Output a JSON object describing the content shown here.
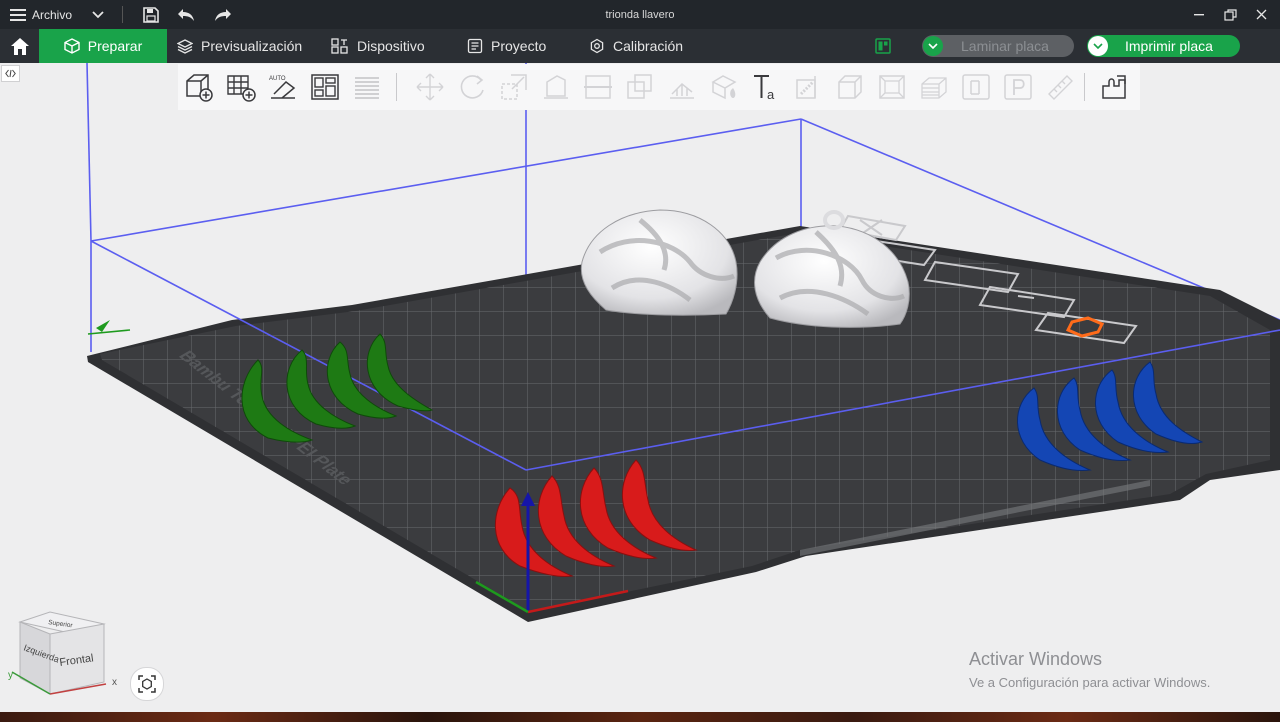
{
  "app": {
    "menu_label": "Archivo",
    "window_title": "trionda llavero"
  },
  "nav": {
    "tabs": [
      {
        "label": "Preparar",
        "icon": "cube-icon",
        "active": true
      },
      {
        "label": "Previsualización",
        "icon": "layers-icon",
        "active": false
      },
      {
        "label": "Dispositivo",
        "icon": "device-icon",
        "active": false
      },
      {
        "label": "Proyecto",
        "icon": "project-icon",
        "active": false
      },
      {
        "label": "Calibración",
        "icon": "calibration-icon",
        "active": false
      }
    ],
    "slice_label": "Laminar placa",
    "print_label": "Imprimir placa"
  },
  "colors": {
    "accent": "#19a34a",
    "titlebar": "#22262b",
    "menubar": "#2b2f34",
    "bed": "#3b3c3f",
    "bounding_box": "#5b5ef0",
    "part_white": "#e8e8ea",
    "part_green": "#1e7a14",
    "part_red": "#d81b1b",
    "part_blue": "#1446b4"
  },
  "toolbar": {
    "items": [
      "add-object-icon",
      "add-plate-icon",
      "auto-arrange-icon",
      "orient-icon",
      "arrange-plate-icon",
      "layers-stack-icon",
      "move-icon",
      "rotate-icon",
      "scale-icon",
      "lay-on-face-icon",
      "cut-icon",
      "boolean-icon",
      "support-paint-icon",
      "seam-paint-icon",
      "text-icon",
      "measure-icon",
      "assembly-icon",
      "emboss-icon",
      "svg-icon",
      "variable-layer-icon",
      "brim-ears-icon",
      "height-range-icon",
      "ruler-icon",
      "split-icon"
    ]
  },
  "scene": {
    "plate_label": "Bambu Textured PEI Plate"
  },
  "viewcube": {
    "top_label": "Superior",
    "left_label": "Izquierda",
    "front_label": "Frontal",
    "x_axis": "x",
    "y_axis": "y"
  },
  "watermark": {
    "title": "Activar Windows",
    "subtitle": "Ve a Configuración para activar Windows."
  }
}
